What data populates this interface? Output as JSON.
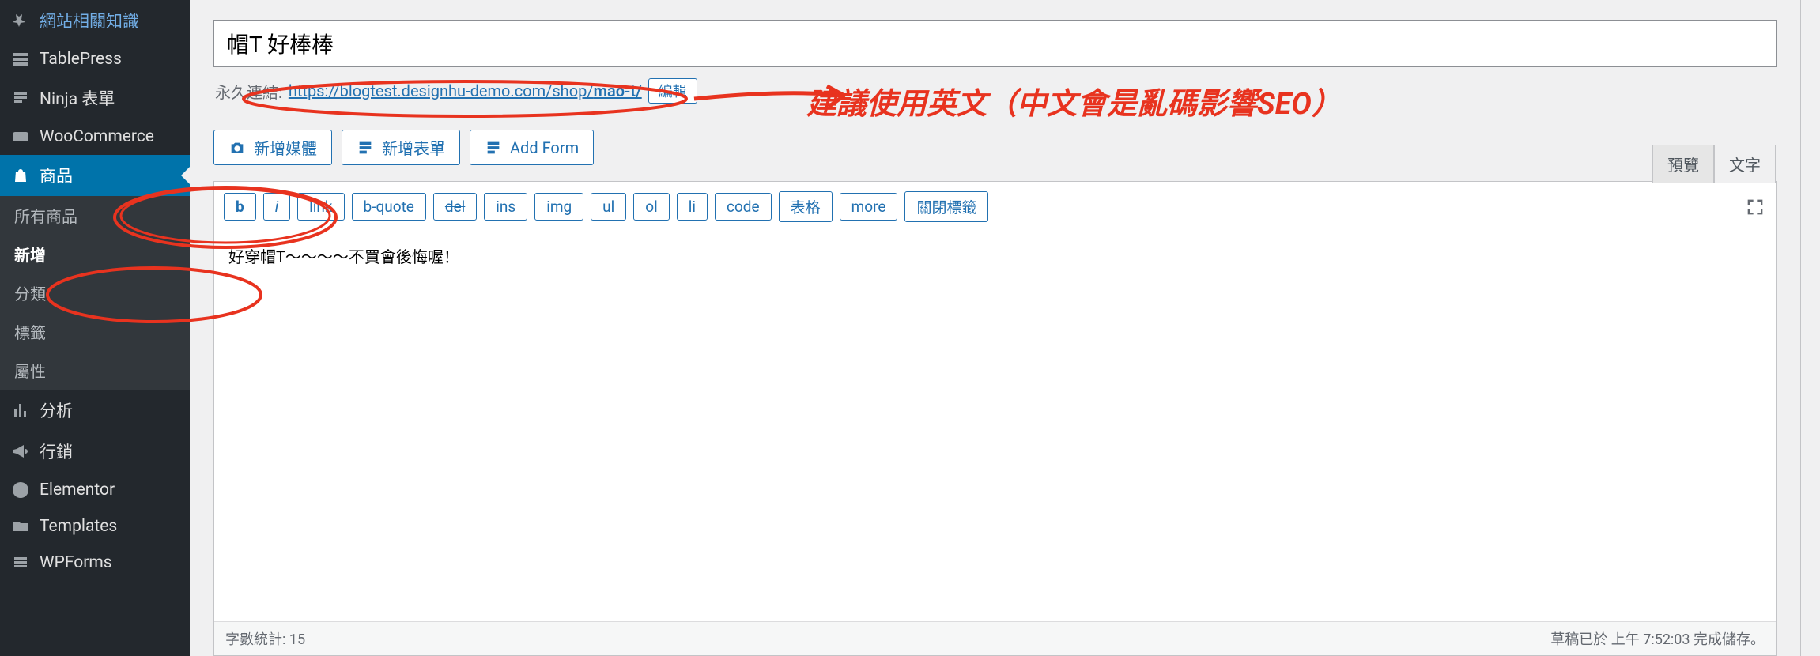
{
  "sidebar": {
    "items": [
      {
        "icon": "pin",
        "label": "網站相關知識"
      },
      {
        "icon": "table",
        "label": "TablePress"
      },
      {
        "icon": "list",
        "label": "Ninja 表單"
      },
      {
        "icon": "woo",
        "label": "WooCommerce"
      },
      {
        "icon": "bag",
        "label": "商品",
        "active": true
      },
      {
        "icon": "chart",
        "label": "分析"
      },
      {
        "icon": "megaphone",
        "label": "行銷"
      },
      {
        "icon": "elementor",
        "label": "Elementor"
      },
      {
        "icon": "folder",
        "label": "Templates"
      },
      {
        "icon": "list",
        "label": "WPForms"
      }
    ],
    "submenu": [
      {
        "label": "所有商品"
      },
      {
        "label": "新增",
        "current": true
      },
      {
        "label": "分類"
      },
      {
        "label": "標籤"
      },
      {
        "label": "屬性"
      }
    ]
  },
  "title": {
    "value": "帽T 好棒棒"
  },
  "permalink": {
    "label": "永久連結:",
    "base": "https://blogtest.designhu-demo.com/shop/",
    "slug": "mao-t/",
    "edit": "編輯"
  },
  "annotation": {
    "text": "建議使用英文（中文會是亂碼影響SEO）"
  },
  "media": [
    {
      "icon": "camera",
      "label": "新增媒體"
    },
    {
      "icon": "form",
      "label": "新增表單"
    },
    {
      "icon": "form",
      "label": "Add Form"
    }
  ],
  "editor": {
    "tabs": [
      {
        "label": "預覽"
      },
      {
        "label": "文字",
        "active": true
      }
    ],
    "toolbar": [
      {
        "key": "b",
        "label": "b"
      },
      {
        "key": "i",
        "label": "i"
      },
      {
        "key": "link",
        "label": "link"
      },
      {
        "key": "bquote",
        "label": "b-quote"
      },
      {
        "key": "del",
        "label": "del"
      },
      {
        "key": "ins",
        "label": "ins"
      },
      {
        "key": "img",
        "label": "img"
      },
      {
        "key": "ul",
        "label": "ul"
      },
      {
        "key": "ol",
        "label": "ol"
      },
      {
        "key": "li",
        "label": "li"
      },
      {
        "key": "code",
        "label": "code"
      },
      {
        "key": "table",
        "label": "表格"
      },
      {
        "key": "more",
        "label": "more"
      },
      {
        "key": "close",
        "label": "關閉標籤"
      }
    ],
    "content": "好穿帽T～～～～不買會後悔喔！",
    "wordcount": "字數統計: 15",
    "savestatus": "草稿已於 上午 7:52:03 完成儲存。"
  }
}
